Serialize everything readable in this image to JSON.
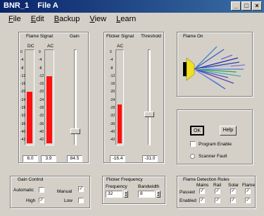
{
  "window": {
    "title": "BNR_1    File A",
    "min": "_",
    "max": "□",
    "close": "×"
  },
  "menu": [
    "File",
    "Edit",
    "Backup",
    "View",
    "Learn"
  ],
  "flame_signal": {
    "title": "Flame Signal",
    "dc_label": "DC",
    "ac_label": "AC",
    "dc_value": "6.0",
    "ac_value": "3.9",
    "dc_level": 0.55,
    "ac_level": 0.72
  },
  "gain": {
    "title": "Gain",
    "value": "84.5",
    "level": 0.85
  },
  "flicker_signal": {
    "title": "Flicker Signal",
    "ac_label": "AC",
    "value": "-16.4",
    "level": 0.42
  },
  "threshold": {
    "title": "Threshold",
    "value": "-31.0",
    "level": 0.68
  },
  "ticks": [
    "0",
    "-4",
    "-8",
    "-12",
    "-16",
    "-20",
    "-24",
    "-28",
    "-32",
    "-36",
    "-40",
    "-42"
  ],
  "flame_on": {
    "title": "Flame On"
  },
  "actions": {
    "ok": "OK",
    "help": "Help",
    "program_enable": "Program Enable",
    "scanner_fault": "Scanner Fault"
  },
  "gain_control": {
    "title": "Gain Control",
    "automatic": "Automatic",
    "manual": "Manual",
    "high": "High",
    "low": "Low",
    "high_checked": "✓",
    "manual_checked": "✓"
  },
  "flicker_frequency": {
    "title": "Flicker Frequency",
    "frequency_label": "Frequency",
    "bandwidth_label": "Bandwidth",
    "frequency": "32",
    "bandwidth": "8"
  },
  "flame_detection_rules": {
    "title": "Flame Detection Rules",
    "columns": [
      "Mains",
      "Rail",
      "Solar",
      "Flame"
    ],
    "rows": [
      "Passed",
      "Enabled"
    ],
    "passed_mark": "✓",
    "enabled_mark": "✓"
  }
}
